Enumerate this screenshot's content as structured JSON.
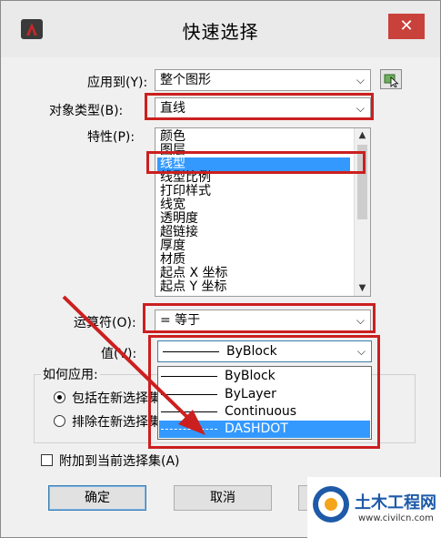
{
  "window": {
    "title": "快速选择",
    "close_glyph": "✕"
  },
  "form": {
    "apply_to": {
      "label": "应用到(Y):",
      "value": "整个图形"
    },
    "object_type": {
      "label": "对象类型(B):",
      "value": "直线"
    },
    "properties": {
      "label": "特性(P):",
      "items": [
        "颜色",
        "图层",
        "线型",
        "线型比例",
        "打印样式",
        "线宽",
        "透明度",
        "超链接",
        "厚度",
        "材质",
        "起点 X 坐标",
        "起点 Y 坐标"
      ],
      "selected": "线型"
    },
    "operator": {
      "label": "运算符(O):",
      "value": "= 等于"
    },
    "value": {
      "label": "值(V):",
      "value": "ByBlock",
      "options": [
        "ByBlock",
        "ByLayer",
        "Continuous",
        "DASHDOT"
      ],
      "highlighted": "DASHDOT"
    },
    "how_to_apply": {
      "title": "如何应用:",
      "include": "包括在新选择集",
      "exclude": "排除在新选择集"
    },
    "append": {
      "label": "附加到当前选择集(A)"
    }
  },
  "buttons": {
    "ok": "确定",
    "cancel": "取消"
  },
  "watermark": {
    "title": "土木工程网",
    "url": "www.civilcn.com"
  },
  "colors": {
    "highlight_red": "#cc1f1f",
    "selection_blue": "#3399ff",
    "close_red": "#c9413b"
  },
  "icons": {
    "app": "autocad-icon",
    "pick": "select-objects-icon",
    "dropdown": "chevron-down-icon"
  }
}
